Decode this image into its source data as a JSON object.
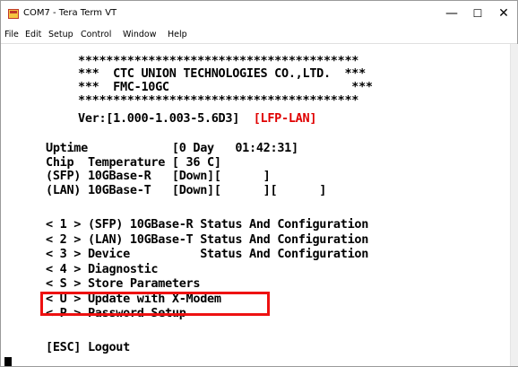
{
  "window": {
    "title": "COM7 - Tera Term VT",
    "controls": {
      "minimize": "—",
      "maximize": "☐",
      "close": "✕"
    }
  },
  "menu": {
    "items": [
      "File",
      "Edit",
      "Setup",
      "Control",
      "Window",
      "Help"
    ]
  },
  "terminal": {
    "border_top": "****************************************",
    "company_line_prefix": "***  CTC UNION TECHNOLOGIES CO.,LTD.  ***",
    "model_line": "***  FMC-10GC                          ***",
    "border_bottom": "****************************************",
    "version_label": "Ver:[1.000-1.003-5.6D3]",
    "version_tag": "[LFP-LAN]",
    "uptime": "Uptime            [0 Day   01:42:31]",
    "chip_temp": "Chip  Temperature [ 36 C]",
    "sfp_status": "(SFP) 10GBase-R   [Down][      ]",
    "lan_status": "(LAN) 10GBase-T   [Down][      ][      ]",
    "menu_options": [
      "< 1 > (SFP) 10GBase-R Status And Configuration",
      "< 2 > (LAN) 10GBase-T Status And Configuration",
      "< 3 > Device          Status And Configuration",
      "< 4 > Diagnostic",
      "< S > Store Parameters",
      "< U > Update with X-Modem",
      "< P > Password Setup"
    ],
    "logout": "[ESC] Logout"
  },
  "colors": {
    "highlight": "#ee1111",
    "version_tag": "#e00000",
    "text": "#000000",
    "background": "#ffffff"
  }
}
